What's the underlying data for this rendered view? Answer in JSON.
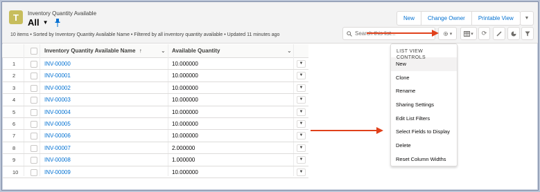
{
  "header": {
    "object_label": "Inventory Quantity Available",
    "list_view_name": "All",
    "subtitle": "10 items • Sorted by Inventory Quantity Available Name • Filtered by all inventory quantity available • Updated 11 minutes ago",
    "icon_letter": "T"
  },
  "actions": {
    "new_label": "New",
    "change_owner_label": "Change Owner",
    "printable_view_label": "Printable View"
  },
  "search": {
    "placeholder": "Search this list..."
  },
  "table": {
    "columns": [
      "Inventory Quantity Available Name",
      "Available Quantity"
    ],
    "sort_indicator": "↑",
    "rows": [
      {
        "num": "1",
        "name": "INV-00000",
        "qty": "10.000000"
      },
      {
        "num": "2",
        "name": "INV-00001",
        "qty": "10.000000"
      },
      {
        "num": "3",
        "name": "INV-00002",
        "qty": "10.000000"
      },
      {
        "num": "4",
        "name": "INV-00003",
        "qty": "10.000000"
      },
      {
        "num": "5",
        "name": "INV-00004",
        "qty": "10.000000"
      },
      {
        "num": "6",
        "name": "INV-00005",
        "qty": "10.000000"
      },
      {
        "num": "7",
        "name": "INV-00006",
        "qty": "10.000000"
      },
      {
        "num": "8",
        "name": "INV-00007",
        "qty": "2.000000"
      },
      {
        "num": "9",
        "name": "INV-00008",
        "qty": "1.000000"
      },
      {
        "num": "10",
        "name": "INV-00009",
        "qty": "10.000000"
      }
    ]
  },
  "list_view_controls": {
    "heading": "LIST VIEW CONTROLS",
    "items": [
      "New",
      "Clone",
      "Rename",
      "Sharing Settings",
      "Edit List Filters",
      "Select Fields to Display",
      "Delete",
      "Reset Column Widths"
    ]
  },
  "colors": {
    "link": "#0070d2",
    "icon_bg": "#c7bd5c",
    "annotation_arrow": "#e0401a"
  }
}
